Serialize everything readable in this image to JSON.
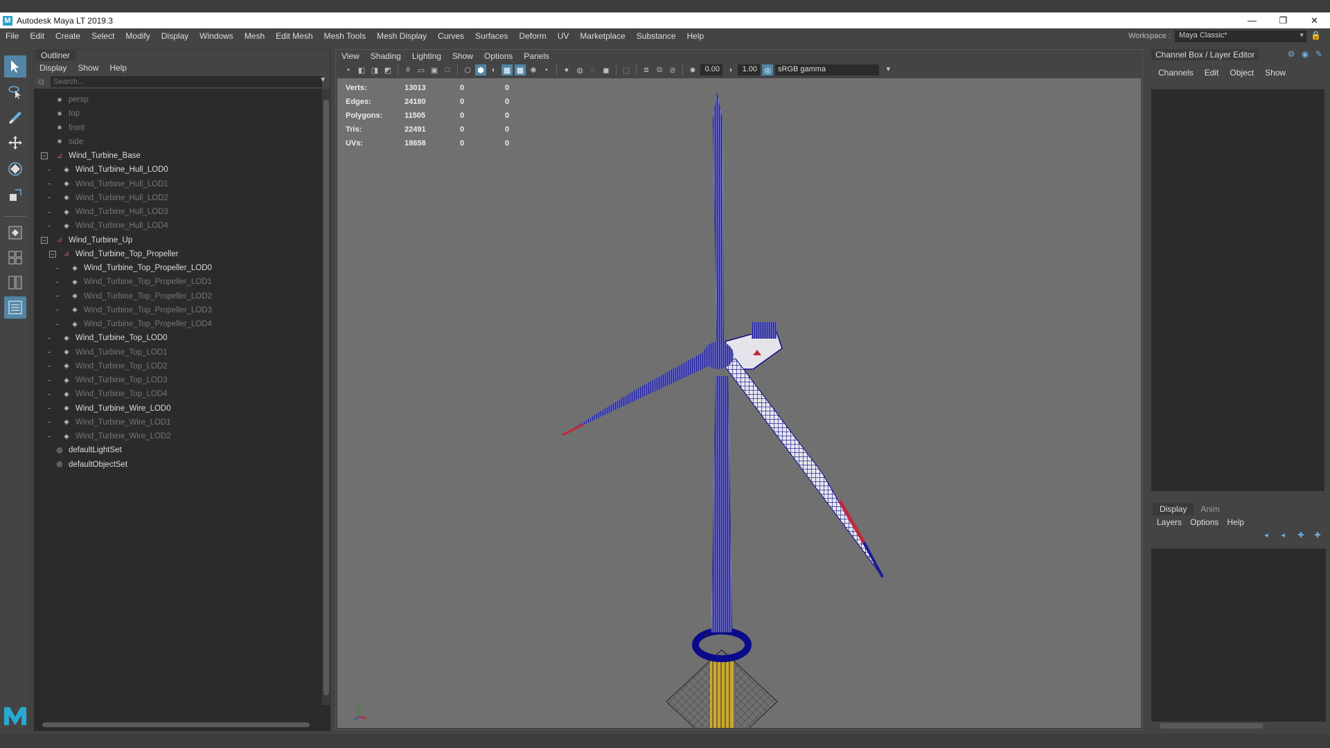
{
  "app": {
    "title": "Autodesk Maya LT 2019.3",
    "logo_letter": "M",
    "window_controls": [
      "—",
      "❐",
      "✕"
    ]
  },
  "menubar": {
    "items": [
      "File",
      "Edit",
      "Create",
      "Select",
      "Modify",
      "Display",
      "Windows",
      "Mesh",
      "Edit Mesh",
      "Mesh Tools",
      "Mesh Display",
      "Curves",
      "Surfaces",
      "Deform",
      "UV",
      "Marketplace",
      "Substance",
      "Help"
    ]
  },
  "workspace": {
    "label": "Workspace :",
    "value": "Maya Classic*"
  },
  "outliner": {
    "tab": "Outliner",
    "menu": [
      "Display",
      "Show",
      "Help"
    ],
    "search_placeholder": "Search...",
    "items": [
      {
        "label": "persp"
      },
      {
        "label": "top"
      },
      {
        "label": "front"
      },
      {
        "label": "side"
      },
      {
        "label": "Wind_Turbine_Base"
      },
      {
        "label": "Wind_Turbine_Hull_LOD0"
      },
      {
        "label": "Wind_Turbine_Hull_LOD1"
      },
      {
        "label": "Wind_Turbine_Hull_LOD2"
      },
      {
        "label": "Wind_Turbine_Hull_LOD3"
      },
      {
        "label": "Wind_Turbine_Hull_LOD4"
      },
      {
        "label": "Wind_Turbine_Up"
      },
      {
        "label": "Wind_Turbine_Top_Propeller"
      },
      {
        "label": "Wind_Turbine_Top_Propeller_LOD0"
      },
      {
        "label": "Wind_Turbine_Top_Propeller_LOD1"
      },
      {
        "label": "Wind_Turbine_Top_Propeller_LOD2"
      },
      {
        "label": "Wind_Turbine_Top_Propeller_LOD3"
      },
      {
        "label": "Wind_Turbine_Top_Propeller_LOD4"
      },
      {
        "label": "Wind_Turbine_Top_LOD0"
      },
      {
        "label": "Wind_Turbine_Top_LOD1"
      },
      {
        "label": "Wind_Turbine_Top_LOD2"
      },
      {
        "label": "Wind_Turbine_Top_LOD3"
      },
      {
        "label": "Wind_Turbine_Top_LOD4"
      },
      {
        "label": "Wind_Turbine_Wire_LOD0"
      },
      {
        "label": "Wind_Turbine_Wire_LOD1"
      },
      {
        "label": "Wind_Turbine_Wire_LOD2"
      },
      {
        "label": "defaultLightSet"
      },
      {
        "label": "defaultObjectSet"
      }
    ]
  },
  "viewport": {
    "menu": [
      "View",
      "Shading",
      "Lighting",
      "Show",
      "Options",
      "Panels"
    ],
    "exposure": "0.00",
    "gamma": "1.00",
    "color_space": "sRGB gamma",
    "hud": [
      {
        "label": "Verts:",
        "value": "13013",
        "sel": "0",
        "comp": "0"
      },
      {
        "label": "Edges:",
        "value": "24180",
        "sel": "0",
        "comp": "0"
      },
      {
        "label": "Polygons:",
        "value": "11505",
        "sel": "0",
        "comp": "0"
      },
      {
        "label": "Tris:",
        "value": "22491",
        "sel": "0",
        "comp": "0"
      },
      {
        "label": "UVs:",
        "value": "18658",
        "sel": "0",
        "comp": "0"
      }
    ],
    "wire_color": "#0a0a8a",
    "accent_red": "#c0283a",
    "base_yellow": "#c9a830"
  },
  "channelbox": {
    "title": "Channel Box / Layer Editor",
    "menu": [
      "Channels",
      "Edit",
      "Object",
      "Show"
    ]
  },
  "layereditor": {
    "tabs": [
      "Display",
      "Anim"
    ],
    "menu": [
      "Layers",
      "Options",
      "Help"
    ]
  },
  "colors": {
    "accent": "#5285a6",
    "panel_bg": "#444444",
    "field_bg": "#2b2b2b"
  }
}
